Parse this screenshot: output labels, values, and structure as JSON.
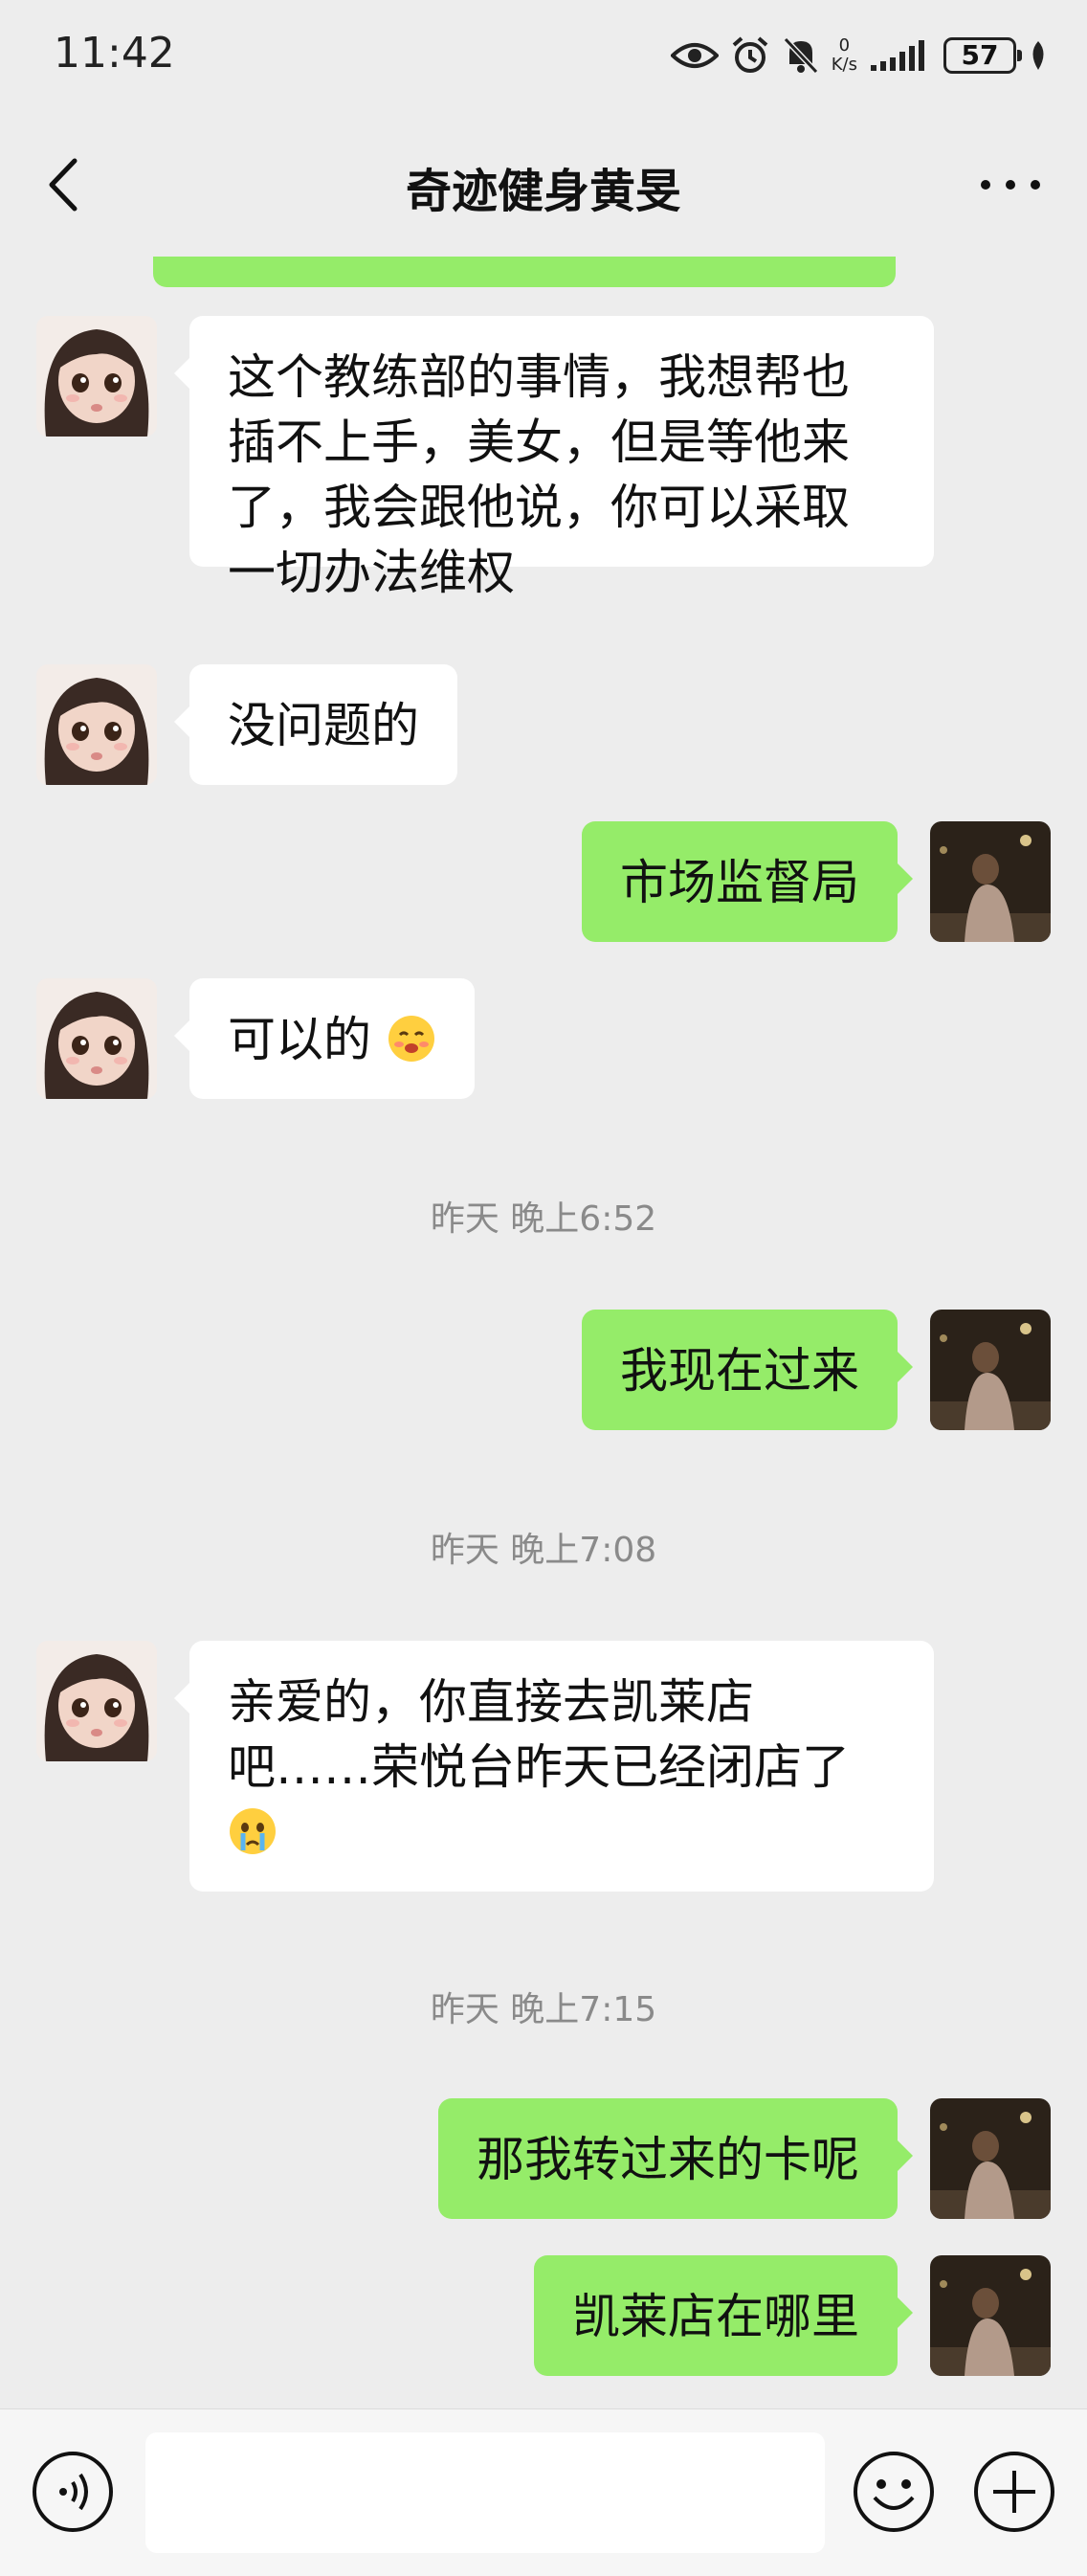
{
  "status": {
    "time": "11:42",
    "net_value": "0",
    "net_unit": "K/s",
    "battery": "57"
  },
  "header": {
    "title": "奇迹健身黄旻"
  },
  "messages": [
    {
      "side": "in",
      "text": "这个教练部的事情，我想帮也插不上手，美女，但是等他来了，我会跟他说，你可以采取一切办法维权"
    },
    {
      "side": "in",
      "text": "没问题的"
    },
    {
      "side": "out",
      "text": "市场监督局"
    },
    {
      "side": "in",
      "text": "可以的",
      "emoji": "blushing-face-emoji"
    },
    {
      "type": "time",
      "text": "昨天 晚上6:52"
    },
    {
      "side": "out",
      "text": "我现在过来"
    },
    {
      "type": "time",
      "text": "昨天 晚上7:08"
    },
    {
      "side": "in",
      "text": "亲爱的，你直接去凯莱店吧……荣悦台昨天已经闭店了",
      "emoji": "crying-face-emoji"
    },
    {
      "type": "time",
      "text": "昨天 晚上7:15"
    },
    {
      "side": "out",
      "text": "那我转过来的卡呢"
    },
    {
      "side": "out",
      "text": "凯莱店在哪里"
    }
  ],
  "input": {
    "value": ""
  },
  "icons": {
    "back": "chevron-left-icon",
    "more": "more-dots-icon",
    "voice": "voice-icon",
    "emoji": "smile-icon",
    "plus": "plus-icon"
  },
  "colors": {
    "outgoing_bubble": "#95ec69",
    "incoming_bubble": "#ffffff",
    "background": "#ededed"
  }
}
